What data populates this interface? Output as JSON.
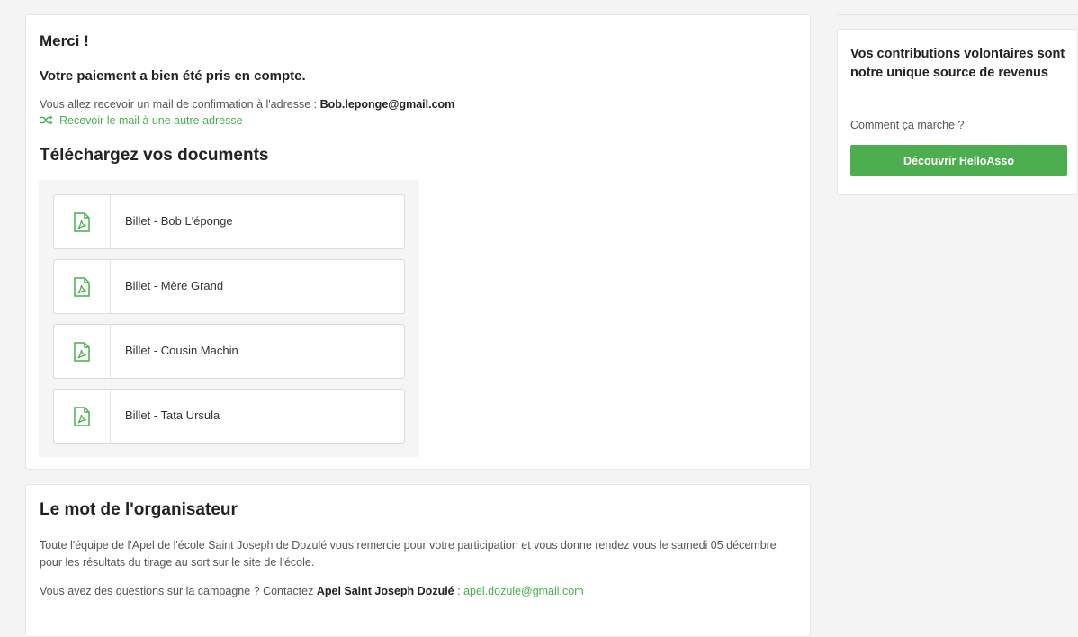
{
  "confirmation": {
    "thanks": "Merci !",
    "payment_status": "Votre paiement a bien été pris en compte.",
    "mail_prefix": "Vous allez recevoir un mail de confirmation à l'adresse : ",
    "mail_address": "Bob.leponge@gmail.com",
    "other_address_link": "Recevoir le mail à une autre adresse",
    "other_address_icon": "shuffle-icon"
  },
  "documents": {
    "title": "Téléchargez vos documents",
    "icon": "pdf-icon",
    "items": [
      {
        "label": "Billet - Bob L'éponge"
      },
      {
        "label": "Billet - Mère Grand"
      },
      {
        "label": "Billet - Cousin Machin"
      },
      {
        "label": "Billet - Tata Ursula"
      }
    ]
  },
  "organizer": {
    "title": "Le mot de l'organisateur",
    "message": "Toute l'équipe de l'Apel de l'école Saint Joseph de Dozulé vous remercie pour votre participation et vous donne rendez vous le samedi 05 décembre pour les résultats du tirage au sort sur le site de l'école.",
    "contact_prefix": "Vous avez des questions sur la campagne ? Contactez ",
    "contact_name": "Apel Saint Joseph Dozulé",
    "contact_separator": " : ",
    "contact_email": "apel.dozule@gmail.com"
  },
  "sidebar": {
    "title": "Vos contributions volontaires sont notre unique source de revenus",
    "how_it_works": "Comment ça marche ?",
    "button_label": "Découvrir HelloAsso"
  },
  "colors": {
    "accent_green": "#49b04f",
    "button_green": "#4cae4f"
  }
}
